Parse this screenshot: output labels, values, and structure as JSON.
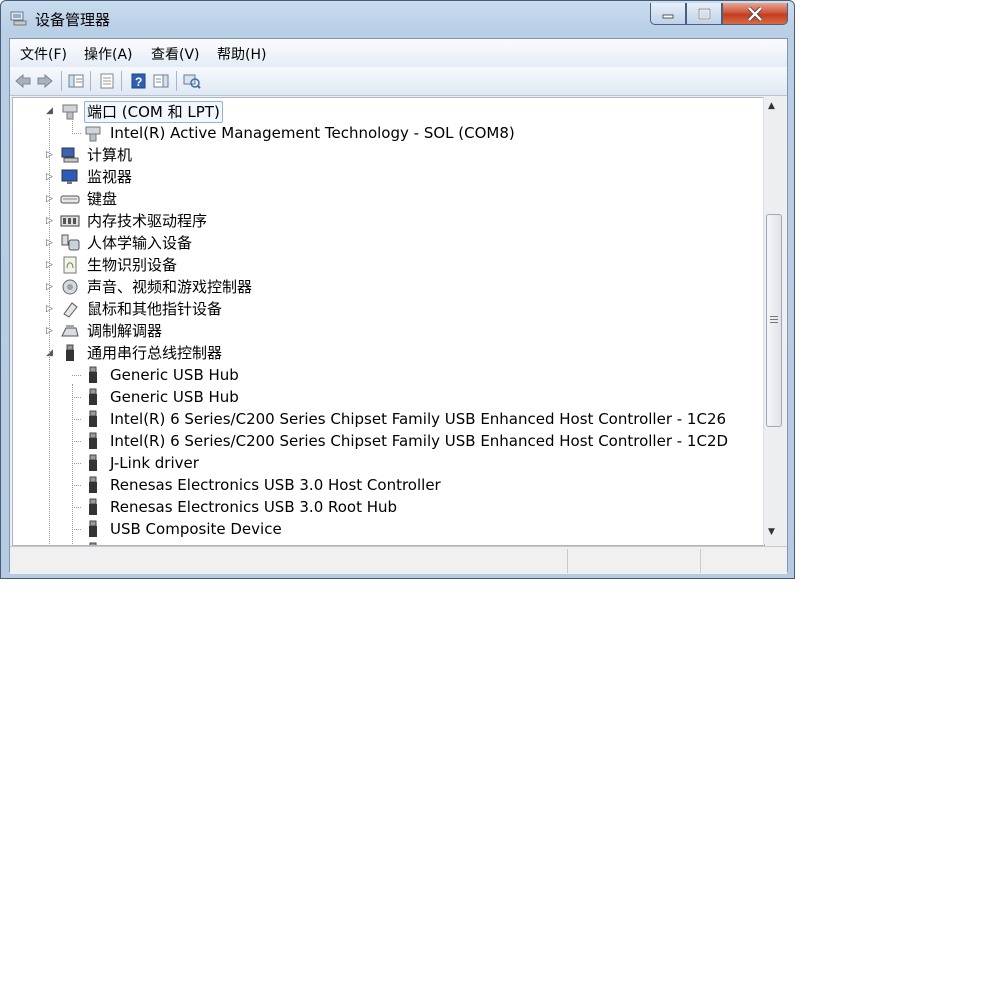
{
  "window": {
    "title": "设备管理器"
  },
  "menu": [
    "文件(F)",
    "操作(A)",
    "查看(V)",
    "帮助(H)"
  ],
  "toolbar": {
    "buttons": [
      "back-icon",
      "forward-icon",
      "show-hide-tree-icon",
      "properties-icon",
      "help-icon",
      "action-pane-icon",
      "scan-hardware-icon"
    ]
  },
  "tree": {
    "rows": [
      {
        "label": "端口 (COM 和 LPT)",
        "level": 0,
        "state": "expanded",
        "icon": "port-icon",
        "selected": true
      },
      {
        "label": "Intel(R) Active Management Technology - SOL (COM8)",
        "level": 1,
        "state": "leaf",
        "icon": "port-icon"
      },
      {
        "label": "计算机",
        "level": 0,
        "state": "collapsed",
        "icon": "computer-icon"
      },
      {
        "label": "监视器",
        "level": 0,
        "state": "collapsed",
        "icon": "monitor-icon"
      },
      {
        "label": "键盘",
        "level": 0,
        "state": "collapsed",
        "icon": "keyboard-icon"
      },
      {
        "label": "内存技术驱动程序",
        "level": 0,
        "state": "collapsed",
        "icon": "memory-icon"
      },
      {
        "label": "人体学输入设备",
        "level": 0,
        "state": "collapsed",
        "icon": "hid-icon"
      },
      {
        "label": "生物识别设备",
        "level": 0,
        "state": "collapsed",
        "icon": "biometric-icon"
      },
      {
        "label": "声音、视频和游戏控制器",
        "level": 0,
        "state": "collapsed",
        "icon": "sound-icon"
      },
      {
        "label": "鼠标和其他指针设备",
        "level": 0,
        "state": "collapsed",
        "icon": "mouse-icon"
      },
      {
        "label": "调制解调器",
        "level": 0,
        "state": "collapsed",
        "icon": "modem-icon"
      },
      {
        "label": "通用串行总线控制器",
        "level": 0,
        "state": "expanded",
        "icon": "usb-icon"
      },
      {
        "label": "Generic USB Hub",
        "level": 1,
        "state": "leaf",
        "icon": "usb-icon"
      },
      {
        "label": "Generic USB Hub",
        "level": 1,
        "state": "leaf",
        "icon": "usb-icon"
      },
      {
        "label": "Intel(R) 6 Series/C200 Series Chipset Family USB Enhanced Host Controller - 1C26",
        "level": 1,
        "state": "leaf",
        "icon": "usb-icon"
      },
      {
        "label": "Intel(R) 6 Series/C200 Series Chipset Family USB Enhanced Host Controller - 1C2D",
        "level": 1,
        "state": "leaf",
        "icon": "usb-icon"
      },
      {
        "label": "J-Link driver",
        "level": 1,
        "state": "leaf",
        "icon": "usb-icon"
      },
      {
        "label": "Renesas Electronics USB 3.0 Host Controller",
        "level": 1,
        "state": "leaf",
        "icon": "usb-icon"
      },
      {
        "label": "Renesas Electronics USB 3.0 Root Hub",
        "level": 1,
        "state": "leaf",
        "icon": "usb-icon"
      },
      {
        "label": "USB Composite Device",
        "level": 1,
        "state": "leaf",
        "icon": "usb-icon"
      },
      {
        "label": "",
        "level": 1,
        "state": "leaf",
        "icon": "usb-icon"
      }
    ]
  },
  "colors": {
    "titlebar": "#c9dcf0",
    "close": "#c43b1e",
    "selection": "#8fb4df"
  }
}
